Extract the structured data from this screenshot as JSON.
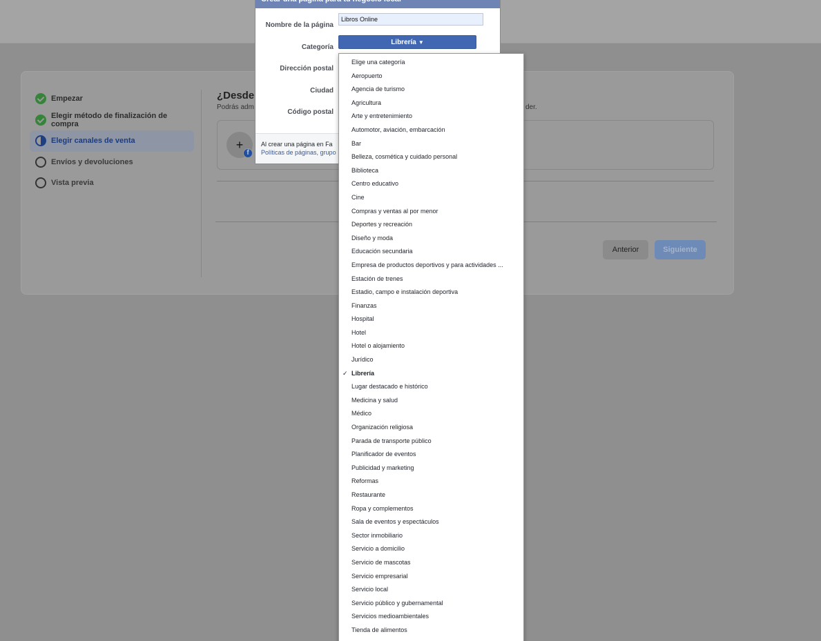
{
  "wizard": {
    "steps": [
      {
        "label": "Empezar",
        "state": "done"
      },
      {
        "label": "Elegir método de finalización de compra",
        "state": "done"
      },
      {
        "label": "Elegir canales de venta",
        "state": "active"
      },
      {
        "label": "Envíos y devoluciones",
        "state": "todo"
      },
      {
        "label": "Vista previa",
        "state": "todo"
      }
    ],
    "content_title_partial": "¿Desde",
    "content_sub_partial": "Podrás adm",
    "content_sub_tail": "der.",
    "add_symbol": "+",
    "fb_badge": "f",
    "prev_label": "Anterior",
    "next_label": "Siguiente"
  },
  "modal": {
    "title": "Crear una página para tu negocio local",
    "fields": {
      "name_label": "Nombre de la página",
      "name_value": "Libros Online",
      "category_label": "Categoría",
      "category_value": "Librería",
      "address_label": "Dirección postal",
      "city_label": "Ciudad",
      "zip_label": "Código postal"
    },
    "footer_text": "Al crear una página en Fa",
    "footer_link": "Políticas de páginas, grupo"
  },
  "dropdown": {
    "selected_index": 23,
    "check_mark": "✓",
    "items": [
      "Elige una categoría",
      "Aeropuerto",
      "Agencia de turismo",
      "Agricultura",
      "Arte y entretenimiento",
      "Automotor, aviación, embarcación",
      "Bar",
      "Belleza, cosmética y cuidado personal",
      "Biblioteca",
      "Centro educativo",
      "Cine",
      "Compras y ventas al por menor",
      "Deportes y recreación",
      "Diseño y moda",
      "Educación secundaria",
      "Empresa de productos deportivos y para actividades ...",
      "Estación de trenes",
      "Estadio, campo e instalación deportiva",
      "Finanzas",
      "Hospital",
      "Hotel",
      "Hotel o alojamiento",
      "Jurídico",
      "Librería",
      "Lugar destacado e histórico",
      "Medicina y salud",
      "Médico",
      "Organización religiosa",
      "Parada de transporte público",
      "Planificador de eventos",
      "Publicidad y marketing",
      "Reformas",
      "Restaurante",
      "Ropa y complementos",
      "Sala de eventos y espectáculos",
      "Sector inmobiliario",
      "Servicio a domicilio",
      "Servicio de mascotas",
      "Servicio empresarial",
      "Servicio local",
      "Servicio público y gubernamental",
      "Servicios medioambientales",
      "Tienda de alimentos"
    ]
  },
  "colors": {
    "modal_header": "#6d84b4",
    "category_button": "#4267b2",
    "overlay": "#8f8f8f"
  }
}
